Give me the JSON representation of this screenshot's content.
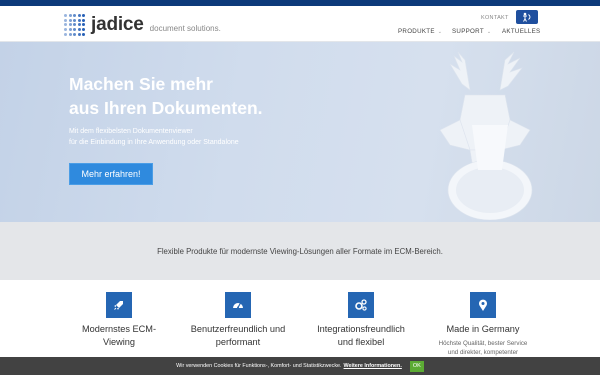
{
  "header": {
    "logo_text": "jadice",
    "logo_tagline": "document solutions.",
    "kontakt_label": "KONTAKT",
    "nav": [
      {
        "label": "PRODUKTE",
        "has_dropdown": true
      },
      {
        "label": "SUPPORT",
        "has_dropdown": true
      },
      {
        "label": "AKTUELLES",
        "has_dropdown": false
      }
    ]
  },
  "hero": {
    "title_line1": "Machen Sie mehr",
    "title_line2": "aus Ihren Dokumenten.",
    "subtitle_line1": "Mit dem flexibelsten Dokumentenviewer",
    "subtitle_line2": "für die Einbindung in Ihre Anwendung oder Standalone",
    "cta_label": "Mehr erfahren!"
  },
  "band": {
    "text": "Flexible Produkte für modernste Viewing-Lösungen aller Formate im ECM-Bereich."
  },
  "features": [
    {
      "icon": "rocket-icon",
      "title_line1": "Modernstes ECM-",
      "title_line2": "Viewing",
      "desc_line1": "",
      "desc_line2": ""
    },
    {
      "icon": "speedometer-icon",
      "title_line1": "Benutzerfreundlich und",
      "title_line2": "performant",
      "desc_line1": "",
      "desc_line2": ""
    },
    {
      "icon": "gears-icon",
      "title_line1": "Integrationsfreundlich",
      "title_line2": "und flexibel",
      "desc_line1": "",
      "desc_line2": ""
    },
    {
      "icon": "location-pin-icon",
      "title_line1": "Made in Germany",
      "title_line2": "",
      "desc_line1": "Höchste Qualität, bester Service",
      "desc_line2": "und direkter, kompetenter"
    }
  ],
  "cookie": {
    "text": "Wir verwenden Cookies für Funktions-, Komfort- und Statistikzwecke.",
    "link_label": "Weitere Informationen.",
    "ok_label": "OK"
  },
  "colors": {
    "brand_dark": "#0d3a7a",
    "accent_blue": "#2566b3",
    "cta_blue": "#2f8ade",
    "ok_green": "#5cab34"
  }
}
